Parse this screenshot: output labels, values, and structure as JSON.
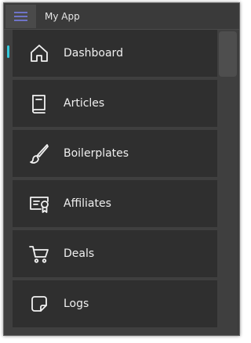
{
  "app": {
    "title": "My App"
  },
  "colors": {
    "accent_indicator": "#33c9dc",
    "hamburger_lines": "#6f74c8"
  },
  "nav": {
    "items": [
      {
        "label": "Dashboard",
        "icon": "home-icon",
        "active": true
      },
      {
        "label": "Articles",
        "icon": "book-icon",
        "active": false
      },
      {
        "label": "Boilerplates",
        "icon": "brush-icon",
        "active": false
      },
      {
        "label": "Affiliates",
        "icon": "certificate-icon",
        "active": false
      },
      {
        "label": "Deals",
        "icon": "cart-icon",
        "active": false
      },
      {
        "label": "Logs",
        "icon": "note-icon",
        "active": false
      }
    ]
  }
}
